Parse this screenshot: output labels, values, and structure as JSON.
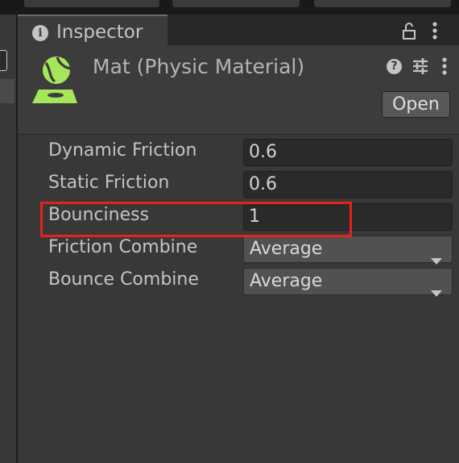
{
  "tab": {
    "label": "Inspector"
  },
  "header": {
    "title": "Mat (Physic Material)",
    "open_label": "Open"
  },
  "properties": [
    {
      "label": "Dynamic Friction",
      "value": "0.6"
    },
    {
      "label": "Static Friction",
      "value": "0.6"
    },
    {
      "label": "Bounciness",
      "value": "1"
    },
    {
      "label": "Friction Combine",
      "value": "Average"
    },
    {
      "label": "Bounce Combine",
      "value": "Average"
    }
  ],
  "colors": {
    "asset_icon": "#a6e65a",
    "highlight": "#e8211a",
    "panel_background": "#383838"
  }
}
